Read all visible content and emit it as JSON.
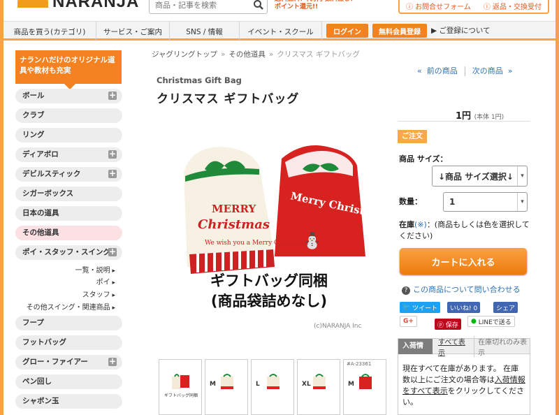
{
  "header": {
    "logo": "NARANJA",
    "search_placeholder": "商品・記事を検索",
    "promo": "送料無料！代引手数料無し！ポイント還元!!",
    "contact": "お問合せフォーム",
    "returns": "返品・交換受付"
  },
  "nav": {
    "tabs": [
      "商品を買う(カテゴリ)",
      "サービス・ご案内",
      "SNS / 情報",
      "イベント・スクール"
    ],
    "login": "ログイン",
    "member": "無料会員登録",
    "register": "ご登録について"
  },
  "sidebar": {
    "banner": "ナランハだけのオリジナル道具や教材も充実",
    "categories": [
      "ボール",
      "クラブ",
      "リング",
      "ディアボロ",
      "デビルスティック",
      "シガーボックス",
      "日本の道具",
      "その他道具",
      "ポイ・スタッフ・スイング"
    ],
    "subitems": [
      "一覧・説明",
      "ポイ",
      "スタッフ",
      "その他スイング・関連商品"
    ],
    "more": [
      "フープ",
      "フットバッグ",
      "グロー・ファイアー",
      "ペン回し",
      "シャボン玉"
    ]
  },
  "breadcrumb": {
    "items": [
      "ジャグリングトップ",
      "その他道具",
      "クリスマス ギフトバッグ"
    ],
    "sep": "»"
  },
  "pager": {
    "prev": "前の商品",
    "next": "次の商品",
    "prev_arrow": "«",
    "next_arrow": "»"
  },
  "product": {
    "title_en": "Christmas Gift Bag",
    "title_jp": "クリスマス ギフトバッグ",
    "image_caption_1": "ギフトバッグ同梱",
    "image_caption_2": "(商品袋詰めなし)",
    "copyright": "(c)NARANJA Inc",
    "bag_text_1": "MERRY",
    "bag_text_2": "Christmas",
    "bag_text_3": "We wish you a Merry Christmas.",
    "bag_text_4": "Merry Christmas"
  },
  "thumbs": [
    {
      "size": "",
      "label": "ギフトバッグ同梱"
    },
    {
      "size": "M",
      "label": ""
    },
    {
      "size": "L",
      "label": ""
    },
    {
      "size": "XL",
      "label": ""
    },
    {
      "size": "M",
      "code": "#A-23361",
      "label": ""
    }
  ],
  "purchase": {
    "price": "1円",
    "price_note": "(本体 1円)",
    "order_label": "ご注文",
    "size_label": "商品 サイズ：",
    "size_value": "↓商品 サイズ選択↓",
    "qty_label": "数量：",
    "qty_value": "1",
    "stock_label": "在庫",
    "stock_mark": "(※)",
    "stock_text": "：(商品もしくは色を選択してください)",
    "cart": "カートに入れる",
    "ask": "この商品について問い合わせる"
  },
  "social": {
    "tweet": "ツイート",
    "like": "いいね! 0",
    "share": "シェア",
    "gplus": "G+",
    "save": "保存",
    "line": "LINEで送る"
  },
  "stockinfo": {
    "tab1": "入荷情報",
    "tab2": "すべて表示",
    "tab3": "在庫切れのみ表示",
    "text1": "現在すべて在庫があります。 在庫数以上にご注文の場合等は",
    "link": "入荷情報をすべて表示",
    "text2": "をクリックしてください。"
  },
  "colors": {
    "accent": "#f58220",
    "link": "#2f6fb3"
  }
}
